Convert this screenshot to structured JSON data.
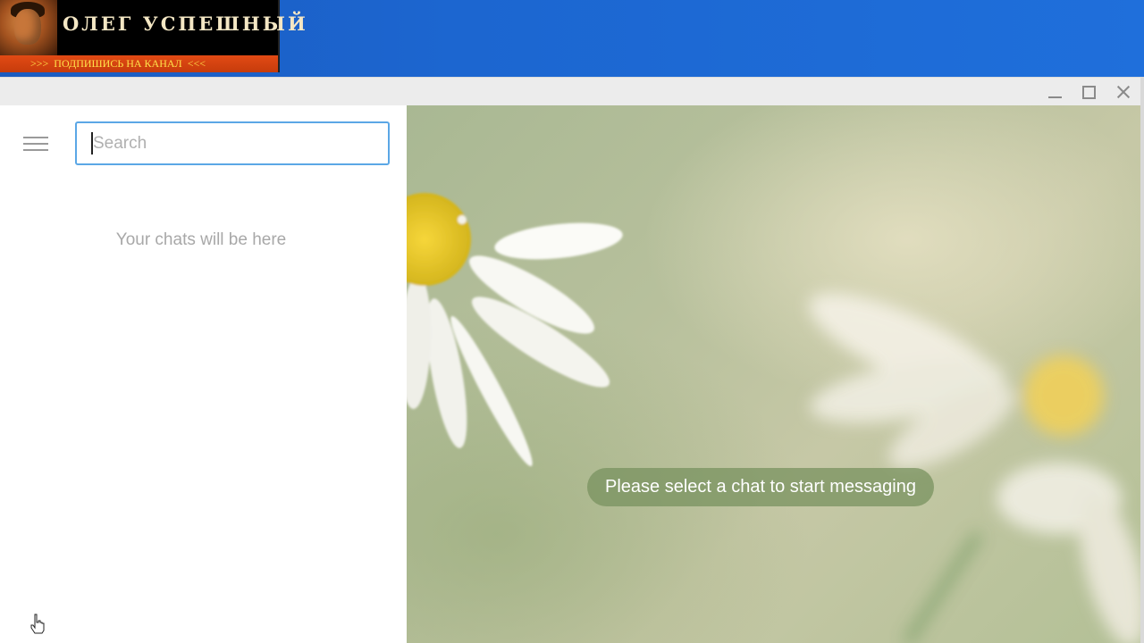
{
  "overlay": {
    "channel_title": "ОЛЕГ УСПЕШНЫЙ",
    "channel_subtitle": ">>>  ПОДПИШИСЬ НА КАНАЛ  <<<"
  },
  "window": {
    "controls": [
      "minimize",
      "maximize",
      "close"
    ]
  },
  "sidebar": {
    "menu_icon": "hamburger-menu-icon",
    "search": {
      "placeholder": "Search",
      "value": ""
    },
    "empty_state": "Your chats will be here"
  },
  "chat": {
    "prompt": "Please select a chat to start messaging",
    "background": "daisy-wallpaper"
  },
  "colors": {
    "search_border": "#5ba7e6",
    "desktop": "#1c66d0",
    "banner_strip": "#d64412",
    "banner_strip_text": "#ffe14a",
    "pill": "#78915f"
  }
}
